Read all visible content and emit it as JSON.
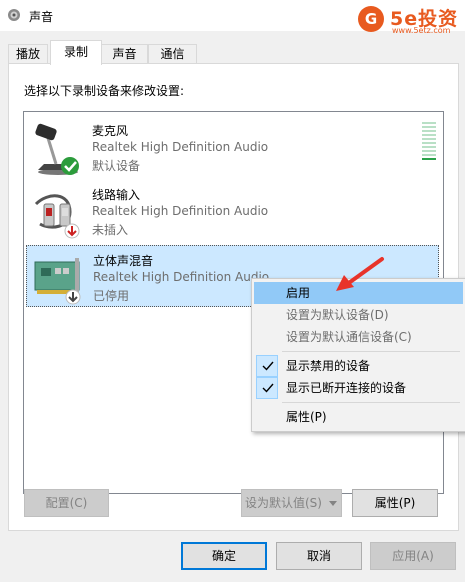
{
  "window": {
    "title": "声音"
  },
  "watermark": {
    "logo": "G",
    "brand": "5e投资",
    "url": "www.5etz.com"
  },
  "tabs": [
    {
      "label": "播放"
    },
    {
      "label": "录制"
    },
    {
      "label": "声音"
    },
    {
      "label": "通信"
    }
  ],
  "panel": {
    "instruction": "选择以下录制设备来修改设置:"
  },
  "devices": [
    {
      "name": "麦克风",
      "driver": "Realtek High Definition Audio",
      "status": "默认设备",
      "icon": "microphone-icon",
      "badge": "default-check-icon"
    },
    {
      "name": "线路输入",
      "driver": "Realtek High Definition Audio",
      "status": "未插入",
      "icon": "line-in-cable-icon",
      "badge": "unplugged-icon"
    },
    {
      "name": "立体声混音",
      "driver": "Realtek High Definition Audio",
      "status": "已停用",
      "icon": "sound-card-icon",
      "badge": "disabled-icon"
    }
  ],
  "level_meter": {
    "bars": 10,
    "active": 1
  },
  "context_menu": {
    "items": [
      {
        "label": "启用",
        "highlighted": true,
        "disabled": false
      },
      {
        "label": "设置为默认设备(D)",
        "disabled": true
      },
      {
        "label": "设置为默认通信设备(C)",
        "disabled": true
      },
      {
        "label": "显示禁用的设备",
        "checked": true
      },
      {
        "label": "显示已断开连接的设备",
        "checked": true
      },
      {
        "label": "属性(P)"
      }
    ]
  },
  "buttons": {
    "configure": "配置(C)",
    "set_default": "设为默认值(S)",
    "properties": "属性(P)",
    "ok": "确定",
    "cancel": "取消",
    "apply": "应用(A)"
  },
  "colors": {
    "selection": "#cce8ff",
    "menu_highlight": "#91c9f7",
    "accent": "#0078d7",
    "arrow": "#e8332a",
    "level_on": "#2aa14a"
  }
}
